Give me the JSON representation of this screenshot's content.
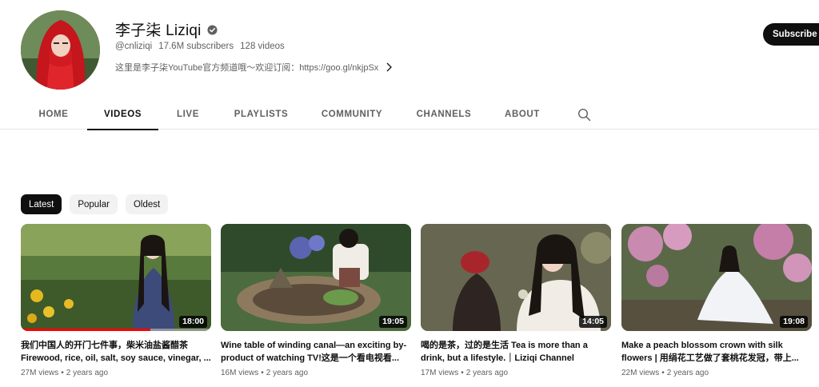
{
  "channel": {
    "name": "李子柒 Liziqi",
    "handle": "@cnliziqi",
    "subscribers": "17.6M subscribers",
    "video_count": "128 videos",
    "description": "这里是李子柒YouTube官方频道哦～欢迎订阅：https://goo.gl/nkjpSx",
    "subscribe_label": "Subscribe",
    "avatar_icon": "avatar-red-veil"
  },
  "tabs": [
    {
      "label": "HOME",
      "active": false
    },
    {
      "label": "VIDEOS",
      "active": true
    },
    {
      "label": "LIVE",
      "active": false
    },
    {
      "label": "PLAYLISTS",
      "active": false
    },
    {
      "label": "COMMUNITY",
      "active": false
    },
    {
      "label": "CHANNELS",
      "active": false
    },
    {
      "label": "ABOUT",
      "active": false
    }
  ],
  "search_icon": "search-icon",
  "chips": [
    {
      "label": "Latest",
      "selected": true
    },
    {
      "label": "Popular",
      "selected": false
    },
    {
      "label": "Oldest",
      "selected": false
    }
  ],
  "videos": [
    {
      "title": "我们中国人的开门七件事，柴米油盐酱醋茶 Firewood, rice, oil, salt, soy sauce, vinegar, ...",
      "duration": "18:00",
      "views": "27M views",
      "age": "2 years ago",
      "watched_fraction": 0.68
    },
    {
      "title": "Wine table of winding canal—an exciting by-product of watching TV!这是一个看电视看...",
      "duration": "19:05",
      "views": "16M views",
      "age": "2 years ago",
      "watched_fraction": 0
    },
    {
      "title": "喝的是茶，过的是生活 Tea is more than a drink, but a lifestyle.｜Liziqi Channel",
      "duration": "14:05",
      "views": "17M views",
      "age": "2 years ago",
      "watched_fraction": 0
    },
    {
      "title": "Make a peach blossom crown with silk flowers | 用绢花工艺做了套桃花发冠，带上...",
      "duration": "19:08",
      "views": "22M views",
      "age": "2 years ago",
      "watched_fraction": 0
    }
  ],
  "colors": {
    "accent": "#0f0f0f",
    "progress": "#ff0000",
    "secondary_text": "#606060",
    "chip_bg": "#f2f2f2"
  }
}
